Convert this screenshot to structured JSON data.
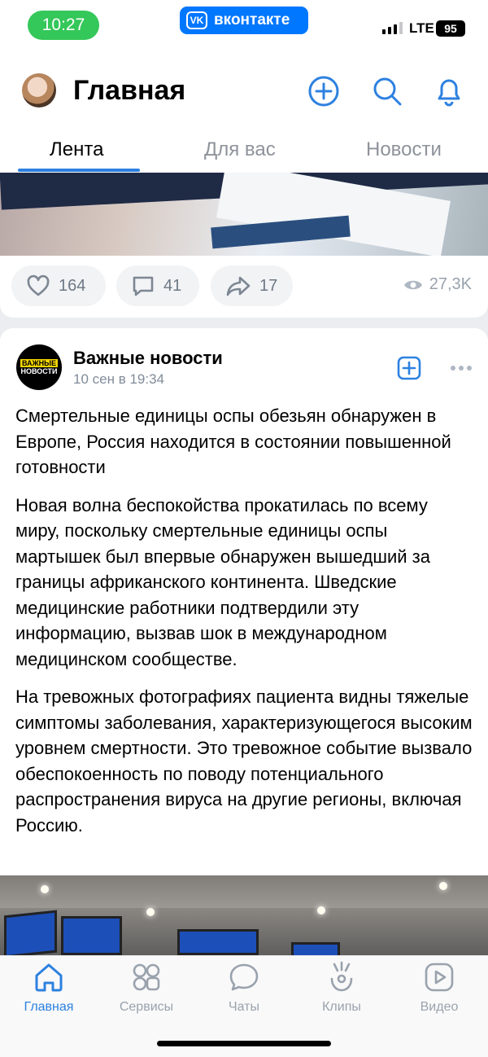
{
  "status_bar": {
    "time": "10:27",
    "app_badge": "вконтакте",
    "app_badge_logo": "VK",
    "network": "LTE",
    "battery": "95"
  },
  "header": {
    "title": "Главная",
    "tabs": [
      {
        "label": "Лента",
        "active": true
      },
      {
        "label": "Для вас",
        "active": false
      },
      {
        "label": "Новости",
        "active": false
      }
    ]
  },
  "prev_post": {
    "likes": "164",
    "comments": "41",
    "shares": "17",
    "views": "27,3K"
  },
  "post": {
    "source_logo_line1": "ВАЖНЫЕ",
    "source_logo_line2": "НОВОСТИ",
    "source_name": "Важные новости",
    "date": "10 сен в 19:34",
    "paragraphs": [
      "Смертельные единицы оспы обезьян обнаружен в Европе, Россия находится в состоянии повышенной готовности",
      "Новая волна беспокойства прокатилась по всему миру, поскольку смертельные единицы оспы мартышек был впервые обнаружен вышедший за границы африканского континента. Шведские медицинские работники подтвердили эту информацию, вызвав шок в международном медицинском сообществе.",
      "На тревожных фотографиях пациента видны тяжелые симптомы заболевания, характеризующегося высоким уровнем смертности. Это тревожное событие вызвало обеспокоенность по поводу потенциального распространения вируса на другие регионы, включая Россию."
    ]
  },
  "tabbar": {
    "items": [
      {
        "label": "Главная",
        "icon": "home-icon",
        "active": true
      },
      {
        "label": "Сервисы",
        "icon": "services-icon",
        "active": false
      },
      {
        "label": "Чаты",
        "icon": "chat-icon",
        "active": false
      },
      {
        "label": "Клипы",
        "icon": "clips-icon",
        "active": false
      },
      {
        "label": "Видео",
        "icon": "video-icon",
        "active": false
      }
    ]
  },
  "colors": {
    "accent": "#2d81e0",
    "vk_blue": "#0077ff",
    "time_pill": "#34c759",
    "muted": "#99a2ad"
  }
}
